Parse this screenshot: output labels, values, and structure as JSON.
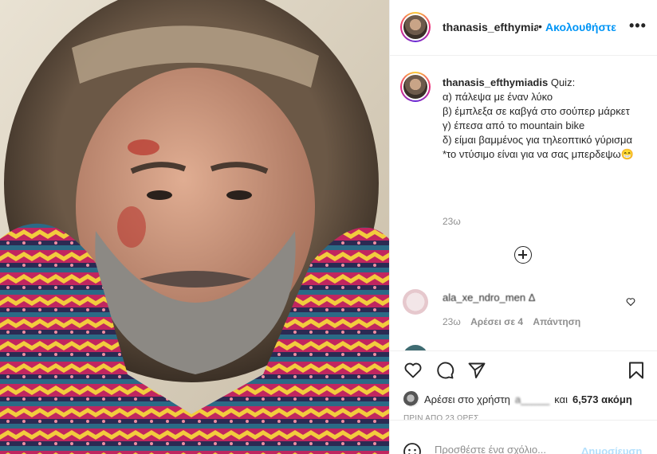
{
  "post": {
    "username": "thanasis_efthymiadis",
    "dot": "•",
    "follow_label": "Ακολουθήστε",
    "more_label": "•••"
  },
  "caption": {
    "username": "thanasis_efthymiadis",
    "lines": [
      "Quiz:",
      "α) πάλεψα με έναν λύκο",
      "β) έμπλεξα σε καβγά στο σούπερ μάρκετ",
      "γ) έπεσα από το mountain bike",
      "δ) είμαι βαμμένος για τηλεοπτικό γύρισμα",
      "*το ντύσιμο είναι για να σας μπερδεψω😁"
    ],
    "time": "23ω"
  },
  "comment": {
    "author_text": "ala_xe_ndro_men Δ",
    "time": "23ω",
    "likes": "Αρέσει σε 4",
    "reply": "Απάντηση"
  },
  "likes": {
    "prefix": "Αρέσει στο χρήστη",
    "user": "a_____",
    "conj": "και",
    "count": "6,573 ακόμη"
  },
  "ago": "ΠΡΙΝ ΑΠΟ 23 ΩΡΕΣ",
  "add_comment": {
    "placeholder": "Προσθέστε ένα σχόλιο...",
    "post_label": "Δημοσίευση"
  },
  "colors": {
    "accent": "#0095f6",
    "muted": "#8e8e8e",
    "post_disabled": "#b2dffc"
  }
}
